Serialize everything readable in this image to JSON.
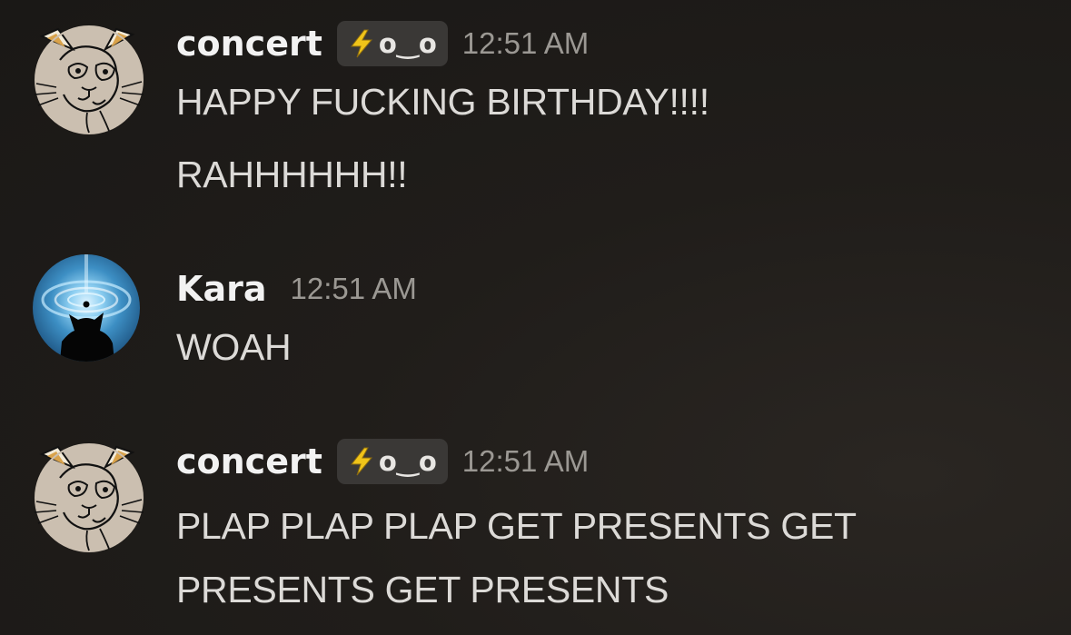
{
  "messages": [
    {
      "author": "concert",
      "avatar_icon": "cat-sketch-avatar-icon",
      "tag": {
        "icon": "lightning-bolt-icon",
        "text": "o‿o"
      },
      "timestamp": "12:51 AM",
      "lines": [
        "HAPPY FUCKING BIRTHDAY!!!!",
        "RAHHHHHH!!"
      ]
    },
    {
      "author": "Kara",
      "avatar_icon": "cat-silhouette-whirlpool-avatar-icon",
      "timestamp": "12:51 AM",
      "lines": [
        "WOAH"
      ]
    },
    {
      "author": "concert",
      "avatar_icon": "cat-sketch-avatar-icon",
      "tag": {
        "icon": "lightning-bolt-icon",
        "text": "o‿o"
      },
      "timestamp": "12:51 AM",
      "lines": [
        "PLAP PLAP PLAP GET PRESENTS GET",
        "PRESENTS GET PRESENTS"
      ]
    }
  ],
  "colors": {
    "background": "#201d1a",
    "username": "#f2f2f2",
    "timestamp": "#9b9893",
    "message_text": "#dcdad7",
    "tag_background": "#3a3836",
    "bolt": "#f0c419"
  }
}
